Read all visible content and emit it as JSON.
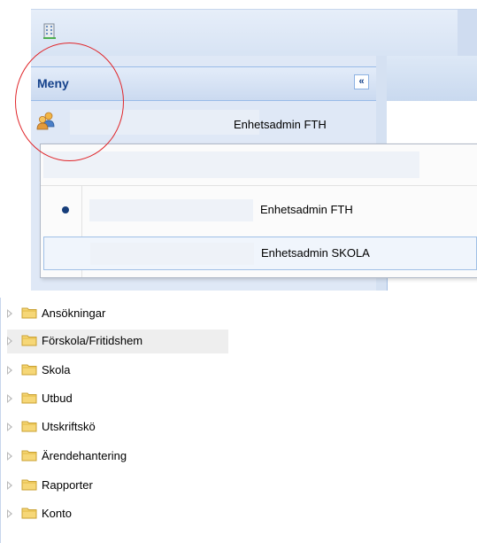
{
  "menu": {
    "title": "Meny",
    "collapse_glyph": "«",
    "current_role": "Enhetsadmin FTH"
  },
  "role_dropdown": {
    "options": [
      {
        "label": "Enhetsadmin FTH",
        "selected_marker": true
      },
      {
        "label": "Enhetsadmin SKOLA",
        "highlighted": true
      }
    ]
  },
  "tree": {
    "items": [
      {
        "label": "Ansökningar"
      },
      {
        "label": "Förskola/Fritidshem"
      },
      {
        "label": "Skola"
      },
      {
        "label": "Utbud"
      },
      {
        "label": "Utskriftskö"
      },
      {
        "label": "Ärendehantering"
      },
      {
        "label": "Rapporter"
      },
      {
        "label": "Konto"
      }
    ]
  },
  "icons": {
    "app": "building-icon",
    "user": "users-icon",
    "collapse": "double-chevron-left-icon",
    "folder": "folder-icon",
    "expand": "triangle-right-icon"
  },
  "colors": {
    "header_text": "#15428b",
    "highlight_circle": "#e0262a",
    "panel_bg": "#dfe8f6",
    "bullet": "#163d7a"
  }
}
